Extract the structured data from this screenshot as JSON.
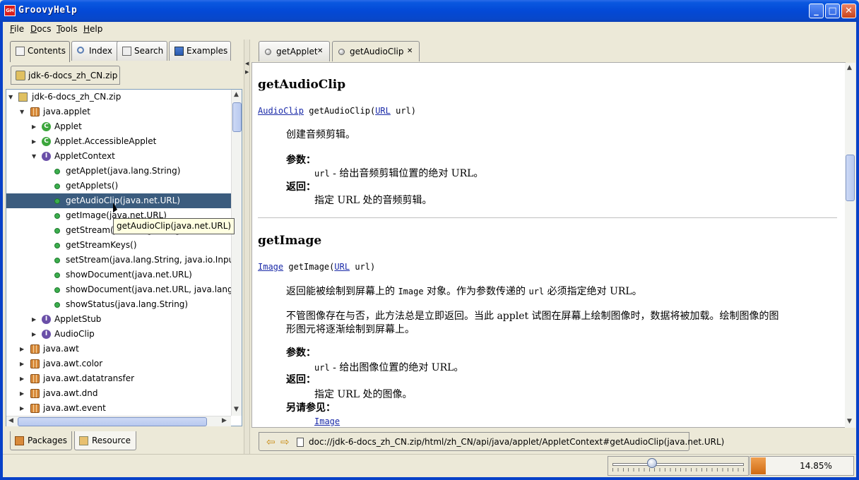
{
  "window": {
    "title": "GroovyHelp",
    "app_icon_text": "GH"
  },
  "menu": [
    "File",
    "Docs",
    "Tools",
    "Help"
  ],
  "left_tabs": [
    "Contents",
    "Index",
    "Search",
    "Examples"
  ],
  "zip_tab": "jdk-6-docs_zh_CN.zip",
  "tree": {
    "root": "jdk-6-docs_zh_CN.zip",
    "pkg_applet": "java.applet",
    "applet": "Applet",
    "accessible_applet": "Applet.AccessibleApplet",
    "applet_context": "AppletContext",
    "methods": [
      "getApplet(java.lang.String)",
      "getApplets()",
      "getAudioClip(java.net.URL)",
      "getImage(java.net.URL)",
      "getStream(java.lang.String)",
      "getStreamKeys()",
      "setStream(java.lang.String, java.io.InputStream)",
      "showDocument(java.net.URL)",
      "showDocument(java.net.URL, java.lang.String)",
      "showStatus(java.lang.String)"
    ],
    "applet_stub": "AppletStub",
    "audio_clip": "AudioClip",
    "packages": [
      "java.awt",
      "java.awt.color",
      "java.awt.datatransfer",
      "java.awt.dnd",
      "java.awt.event"
    ]
  },
  "tooltip": "getAudioClip(java.net.URL)",
  "bottom_tabs": [
    "Packages",
    "Resource"
  ],
  "right_tabs": [
    "getApplet",
    "getAudioClip"
  ],
  "doc": {
    "m1_title": "getAudioClip",
    "m1_sig_type": "AudioClip",
    "m1_sig_name": "getAudioClip(",
    "m1_sig_param_type": "URL",
    "m1_sig_param": "url)",
    "m1_desc": "创建音频剪辑。",
    "params_label": "参数：",
    "m1_param_name": "url",
    "m1_param_desc": "- 给出音频剪辑位置的绝对 URL。",
    "returns_label": "返回：",
    "m1_returns": "指定 URL 处的音频剪辑。",
    "m2_title": "getImage",
    "m2_sig_type": "Image",
    "m2_sig_name": "getImage(",
    "m2_sig_param_type": "URL",
    "m2_sig_param": "url)",
    "m2_desc_a": "返回能被绘制到屏幕上的 ",
    "m2_desc_code": "Image",
    "m2_desc_b": " 对象。作为参数传递的 ",
    "m2_desc_code2": "url",
    "m2_desc_c": " 必须指定绝对 URL。",
    "m2_desc2_line1": "不管图像存在与否，此方法总是立即返回。当此 applet 试图在屏幕上绘制图像时，数据将被加载。绘制图像的图",
    "m2_desc2_line2": "形图元将逐渐绘制到屏幕上。",
    "m2_param_name": "url",
    "m2_param_desc": "- 给出图像位置的绝对 URL。",
    "m2_returns": "指定 URL 处的图像。",
    "see_also_label": "另请参见：",
    "see_also_link": "Image"
  },
  "address": "doc://jdk-6-docs_zh_CN.zip/html/zh_CN/api/java/applet/AppletContext#getAudioClip(java.net.URL)",
  "status": {
    "progress_text": "14.85%",
    "progress_value": 0.1485,
    "slider_value": 0.3
  },
  "colors": {
    "title_bar": "#0349d6",
    "selection": "#3b5c7e",
    "link": "#1a2aa8",
    "progress": "#e07a20"
  }
}
